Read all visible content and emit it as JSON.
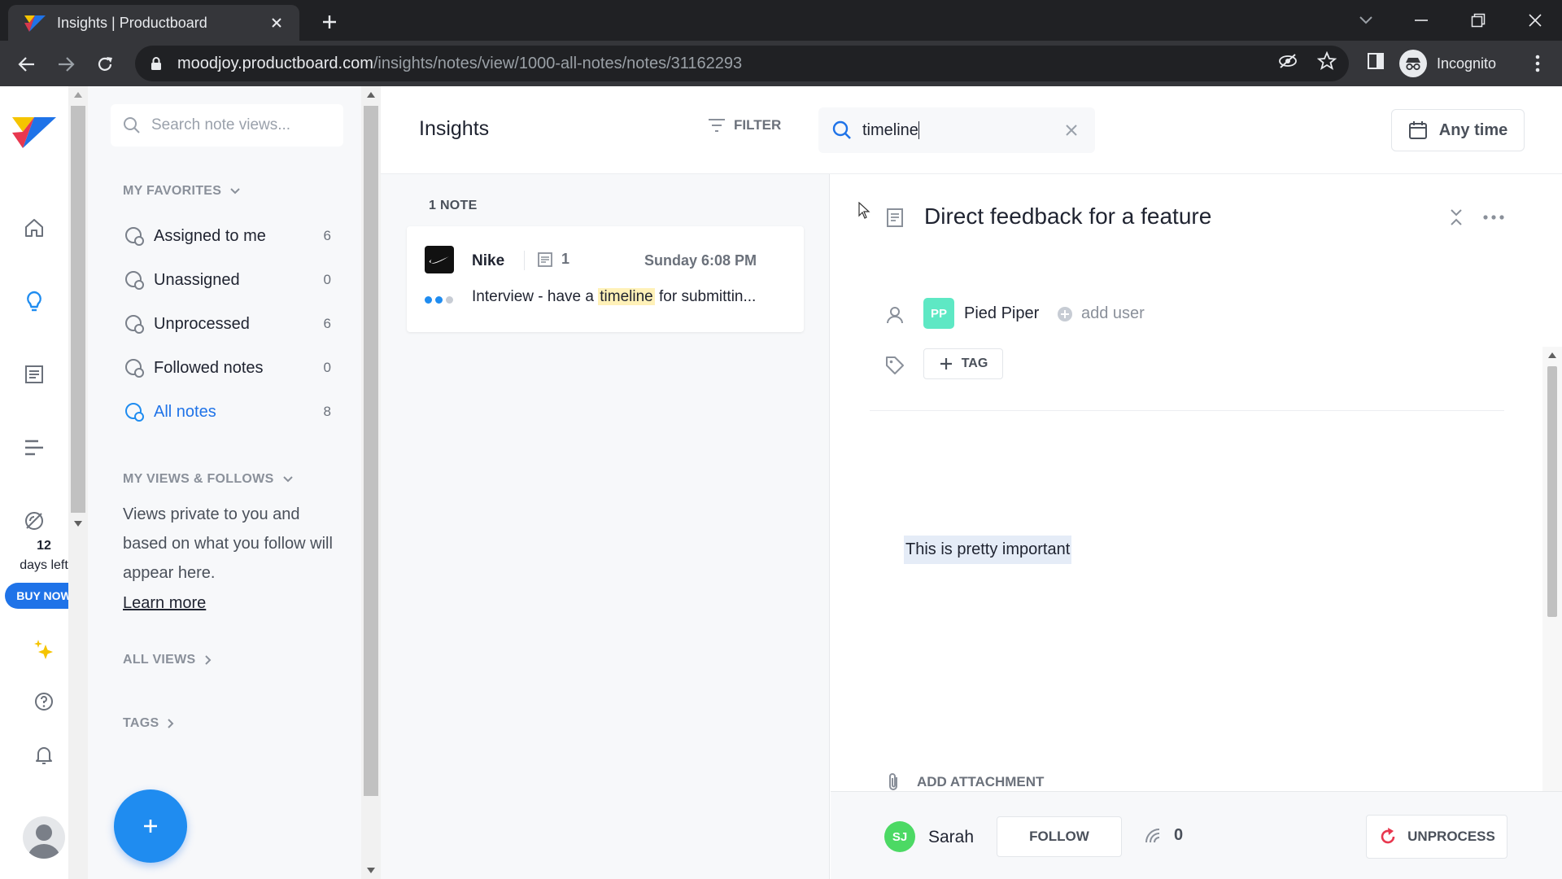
{
  "browser": {
    "tab_title": "Insights | Productboard",
    "url_host": "moodjoy.productboard.com",
    "url_path": "/insights/notes/view/1000-all-notes/notes/31162293",
    "profile_label": "Incognito"
  },
  "rail": {
    "trial_days": "12",
    "trial_label": "days left",
    "buy_label": "BUY NOW",
    "icons": [
      "home-icon",
      "insights-bulb-icon",
      "notes-icon",
      "roadmap-icon",
      "portal-icon",
      "sparkle-icon",
      "help-icon",
      "bell-icon"
    ]
  },
  "nav": {
    "search_placeholder": "Search note views...",
    "favorites_heading": "MY FAVORITES",
    "favorites": [
      {
        "label": "Assigned to me",
        "count": "6"
      },
      {
        "label": "Unassigned",
        "count": "0"
      },
      {
        "label": "Unprocessed",
        "count": "6"
      },
      {
        "label": "Followed notes",
        "count": "0"
      },
      {
        "label": "All notes",
        "count": "8"
      }
    ],
    "views_heading": "MY VIEWS & FOLLOWS",
    "views_text": "Views private to you and based on what you follow will appear here.",
    "learn_more": "Learn more",
    "all_views": "ALL VIEWS",
    "tags": "TAGS"
  },
  "header": {
    "title": "Insights",
    "filter_label": "FILTER",
    "search_value": "timeline",
    "time_label": "Any time"
  },
  "list": {
    "count_label": "1 NOTE",
    "note": {
      "company": "Nike",
      "note_count": "1",
      "date": "Sunday 6:08 PM",
      "text_before": "Interview - have a ",
      "text_highlight": "timeline",
      "text_after": " for submittin..."
    }
  },
  "detail": {
    "title": "Direct feedback for a feature",
    "company_initials": "PP",
    "company_name": "Pied Piper",
    "add_user_label": "add user",
    "tag_label": "TAG",
    "body": "This is pretty important",
    "attachment_label": "ADD ATTACHMENT",
    "owner_initials": "SJ",
    "owner_name": "Sarah",
    "follow_label": "FOLLOW",
    "followers_count": "0",
    "unprocess_label": "UNPROCESS"
  },
  "colors": {
    "accent": "#1f73e8",
    "company_badge": "#5ee8c4",
    "owner_badge": "#4cd964",
    "unprocess_icon": "#e8384f"
  }
}
